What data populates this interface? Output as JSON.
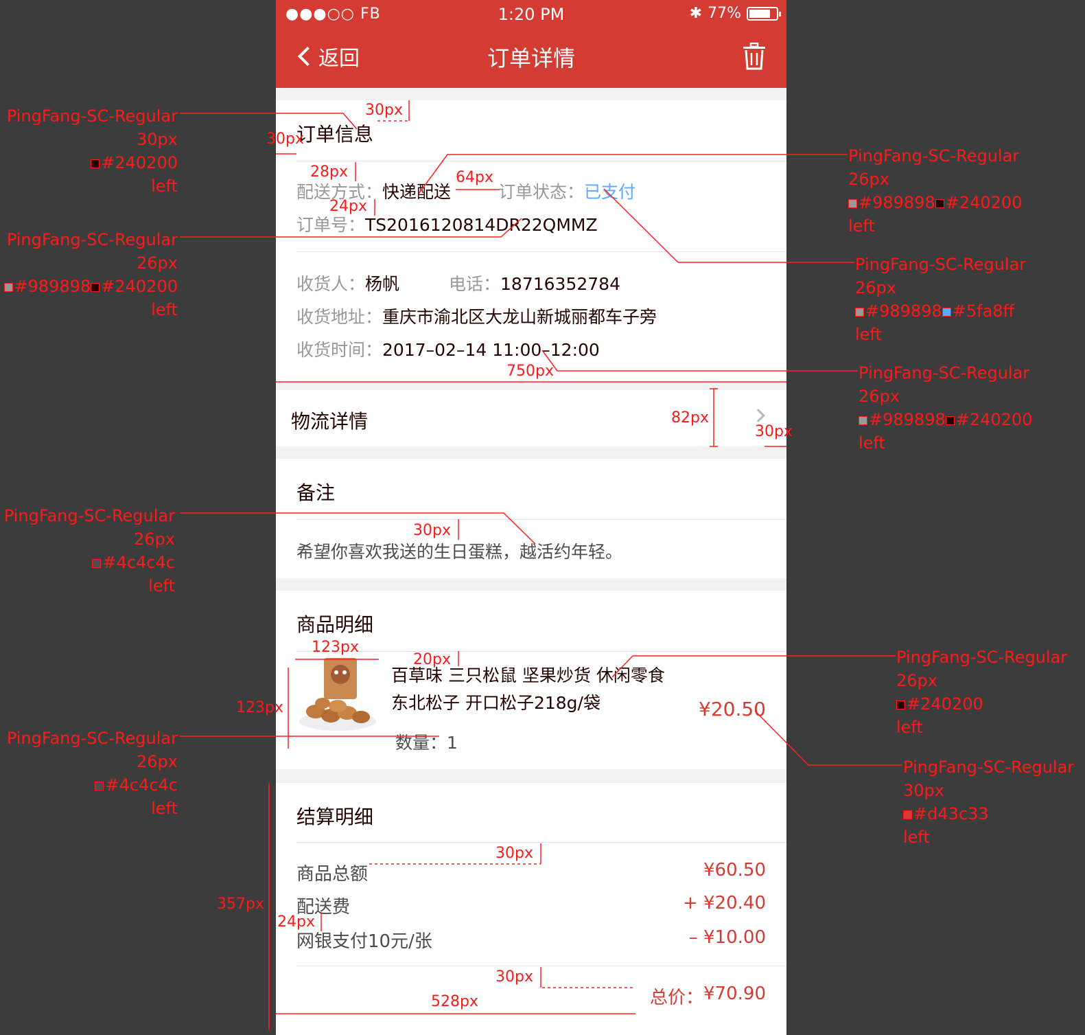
{
  "status_bar": {
    "carrier": "●●●○○ FB",
    "time": "1:20 PM",
    "battery": "77%"
  },
  "navbar": {
    "back_label": "返回",
    "title": "订单详情"
  },
  "order_info": {
    "title": "订单信息",
    "delivery_label": "配送方式：",
    "delivery_value": "快递配送",
    "status_label": "订单状态：",
    "status_value": "已支付",
    "order_no_label": "订单号：",
    "order_no_value": "TS2016120814DR22QMMZ"
  },
  "receiver": {
    "name_label": "收货人：",
    "name_value": "杨帆",
    "phone_label": "电话：",
    "phone_value": "18716352784",
    "address_label": "收货地址：",
    "address_value": "重庆市渝北区大龙山新城丽都车子旁",
    "time_label": "收货时间：",
    "time_value": "2017–02–14   11:00–12:00"
  },
  "logistics": {
    "label": "物流详情"
  },
  "remark": {
    "title": "备注",
    "text": "希望你喜欢我送的生日蛋糕，越活约年轻。"
  },
  "goods": {
    "title": "商品明细",
    "name_line1": "百草味    三只松鼠 坚果炒货 休闲零食",
    "name_line2": "东北松子 开口松子218g/袋",
    "price": "¥20.50",
    "qty_label": "数量：",
    "qty_value": "1"
  },
  "settlement": {
    "title": "结算明细",
    "rows": [
      {
        "label": "商品总额",
        "value": "¥60.50"
      },
      {
        "label": "配送费",
        "value": "+ ¥20.40"
      },
      {
        "label": "网银支付10元/张",
        "value": "– ¥10.00"
      }
    ],
    "total_label": "总价：",
    "total_value": "¥70.90"
  },
  "annotations": {
    "left_1": [
      "PingFang-SC-Regular",
      "30px",
      "#240200",
      "left"
    ],
    "left_2": [
      "PingFang-SC-Regular",
      "26px",
      "#989898",
      "#240200",
      "left"
    ],
    "left_3": [
      "PingFang-SC-Regular",
      "26px",
      "#4c4c4c",
      "left"
    ],
    "left_4": [
      "PingFang-SC-Regular",
      "26px",
      "#4c4c4c",
      "left"
    ],
    "right_1": [
      "PingFang-SC-Regular",
      "26px",
      "#989898",
      "#240200",
      "left"
    ],
    "right_2": [
      "PingFang-SC-Regular",
      "26px",
      "#989898",
      "#5fa8ff",
      "left"
    ],
    "right_3": [
      "PingFang-SC-Regular",
      "26px",
      "#989898",
      "#240200",
      "left"
    ],
    "right_4": [
      "PingFang-SC-Regular",
      "26px",
      "#240200",
      "left"
    ],
    "right_5": [
      "PingFang-SC-Regular",
      "30px",
      "#d43c33",
      "left"
    ],
    "measures": {
      "m30a": "30px",
      "m30b": "30px",
      "m28": "28px",
      "m64": "64px",
      "m24a": "24px",
      "m750": "750px",
      "m82": "82px",
      "m30c": "30px",
      "m30d": "30px",
      "m123a": "123px",
      "m20": "20px",
      "m123b": "123px",
      "m30e": "30px",
      "m357": "357px",
      "m24b": "24px",
      "m30f": "30px",
      "m528": "528px"
    }
  },
  "colors": {
    "brand_red": "#d43c33",
    "text_dark": "#240200",
    "text_gray": "#989898",
    "text_mid": "#4c4c4c",
    "link_blue": "#5fa8ff",
    "annotation_red": "#ff1a1a"
  }
}
